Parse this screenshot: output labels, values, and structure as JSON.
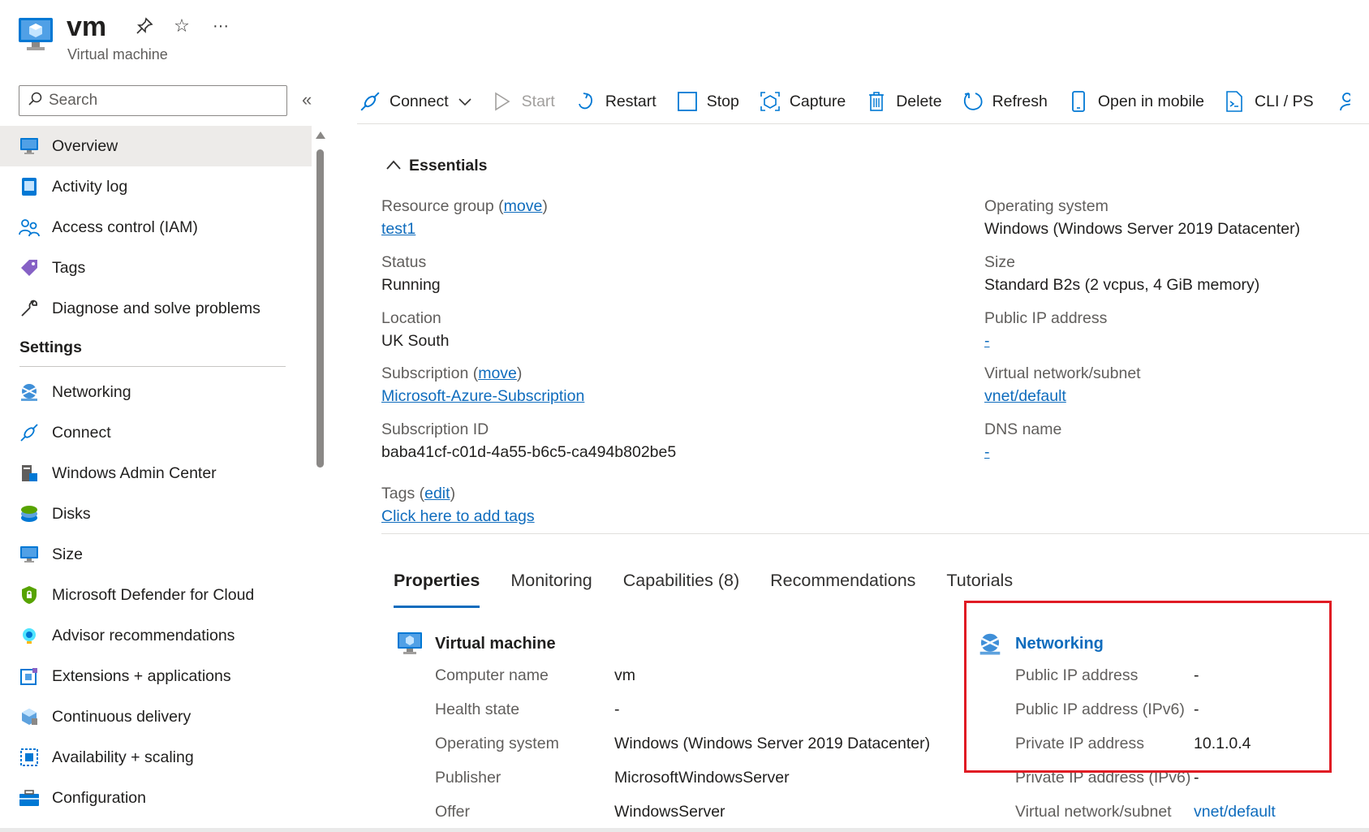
{
  "header": {
    "title": "vm",
    "subtitle": "Virtual machine"
  },
  "sidebar": {
    "search_placeholder": "Search",
    "collapse_glyph": "«",
    "items": [
      {
        "label": "Overview",
        "icon": "monitor-icon"
      },
      {
        "label": "Activity log",
        "icon": "activity-log-icon"
      },
      {
        "label": "Access control (IAM)",
        "icon": "people-icon"
      },
      {
        "label": "Tags",
        "icon": "tag-icon"
      },
      {
        "label": "Diagnose and solve problems",
        "icon": "wrench-icon"
      }
    ],
    "settings_title": "Settings",
    "settings_items": [
      {
        "label": "Networking",
        "icon": "networking-globe-icon"
      },
      {
        "label": "Connect",
        "icon": "plug-icon"
      },
      {
        "label": "Windows Admin Center",
        "icon": "server-icon"
      },
      {
        "label": "Disks",
        "icon": "disk-icon"
      },
      {
        "label": "Size",
        "icon": "monitor-icon"
      },
      {
        "label": "Microsoft Defender for Cloud",
        "icon": "shield-icon"
      },
      {
        "label": "Advisor recommendations",
        "icon": "advisor-icon"
      },
      {
        "label": "Extensions + applications",
        "icon": "extensions-icon"
      },
      {
        "label": "Continuous delivery",
        "icon": "cube-icon"
      },
      {
        "label": "Availability + scaling",
        "icon": "scaling-icon"
      },
      {
        "label": "Configuration",
        "icon": "toolbox-icon"
      }
    ]
  },
  "toolbar": {
    "connect": "Connect",
    "start": "Start",
    "restart": "Restart",
    "stop": "Stop",
    "capture": "Capture",
    "delete": "Delete",
    "refresh": "Refresh",
    "open_mobile": "Open in mobile",
    "cli": "CLI / PS"
  },
  "essentials": {
    "title": "Essentials",
    "resource_group_label": "Resource group (",
    "move_link": "move",
    "close_paren": ")",
    "resource_group": "test1",
    "status_label": "Status",
    "status": "Running",
    "location_label": "Location",
    "location": "UK South",
    "subscription_label": "Subscription (",
    "subscription": "Microsoft-Azure-Subscription",
    "subscription_id_label": "Subscription ID",
    "subscription_id": "baba41cf-c01d-4a55-b6c5-ca494b802be5",
    "tags_label": "Tags (",
    "edit_link": "edit",
    "tags_link": "Click here to add tags",
    "os_label": "Operating system",
    "os": "Windows (Windows Server 2019 Datacenter)",
    "size_label": "Size",
    "size": "Standard B2s (2 vcpus, 4 GiB memory)",
    "public_ip_label": "Public IP address",
    "public_ip": "-",
    "vnet_label": "Virtual network/subnet",
    "vnet": "vnet/default",
    "dns_label": "DNS name",
    "dns": "-"
  },
  "tabs": [
    "Properties",
    "Monitoring",
    "Capabilities (8)",
    "Recommendations",
    "Tutorials"
  ],
  "properties": {
    "vm_title": "Virtual machine",
    "vm_rows": [
      {
        "label": "Computer name",
        "value": "vm"
      },
      {
        "label": "Health state",
        "value": "-"
      },
      {
        "label": "Operating system",
        "value": "Windows (Windows Server 2019 Datacenter)"
      },
      {
        "label": "Publisher",
        "value": "MicrosoftWindowsServer"
      },
      {
        "label": "Offer",
        "value": "WindowsServer"
      }
    ],
    "net_title": "Networking",
    "net_rows": [
      {
        "label": "Public IP address",
        "value": "-"
      },
      {
        "label": "Public IP address (IPv6)",
        "value": "-"
      },
      {
        "label": "Private IP address",
        "value": "10.1.0.4"
      },
      {
        "label": "Private IP address (IPv6)",
        "value": "-"
      },
      {
        "label": "Virtual network/subnet",
        "value": "vnet/default"
      }
    ]
  },
  "colors": {
    "link": "#0f6cbd",
    "highlight_box": "#e01b24",
    "active_nav_bg": "#edebe9"
  }
}
